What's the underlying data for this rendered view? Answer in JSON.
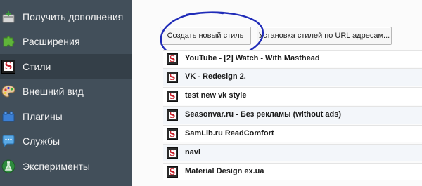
{
  "sidebar": {
    "items": [
      {
        "label": "Получить дополнения",
        "icon": "download-box-icon",
        "selected": false
      },
      {
        "label": "Расширения",
        "icon": "puzzle-piece-icon",
        "selected": false
      },
      {
        "label": "Стили",
        "icon": "stylish-s-icon",
        "selected": true
      },
      {
        "label": "Внешний вид",
        "icon": "palette-icon",
        "selected": false
      },
      {
        "label": "Плагины",
        "icon": "lego-brick-icon",
        "selected": false
      },
      {
        "label": "Службы",
        "icon": "chat-bubble-icon",
        "selected": false
      },
      {
        "label": "Эксперименты",
        "icon": "flask-icon",
        "selected": false
      }
    ]
  },
  "toolbar": {
    "create_label": "Создать новый стиль",
    "install_url_label": "Установка стилей по URL адресам..."
  },
  "styles_list": {
    "items": [
      {
        "title": "YouTube - [2] Watch - With Masthead"
      },
      {
        "title": "VK - Redesign 2."
      },
      {
        "title": "test new vk style"
      },
      {
        "title": "Seasonvar.ru - Без рекламы (without ads)"
      },
      {
        "title": "SamLib.ru ReadComfort"
      },
      {
        "title": "navi"
      },
      {
        "title": "Material Design ex.ua"
      }
    ]
  },
  "icon_letter": "S",
  "colors": {
    "sidebar_bg": "#424f5a",
    "sidebar_selected": "#343f48",
    "annotation_circle": "#1f2bb8"
  }
}
